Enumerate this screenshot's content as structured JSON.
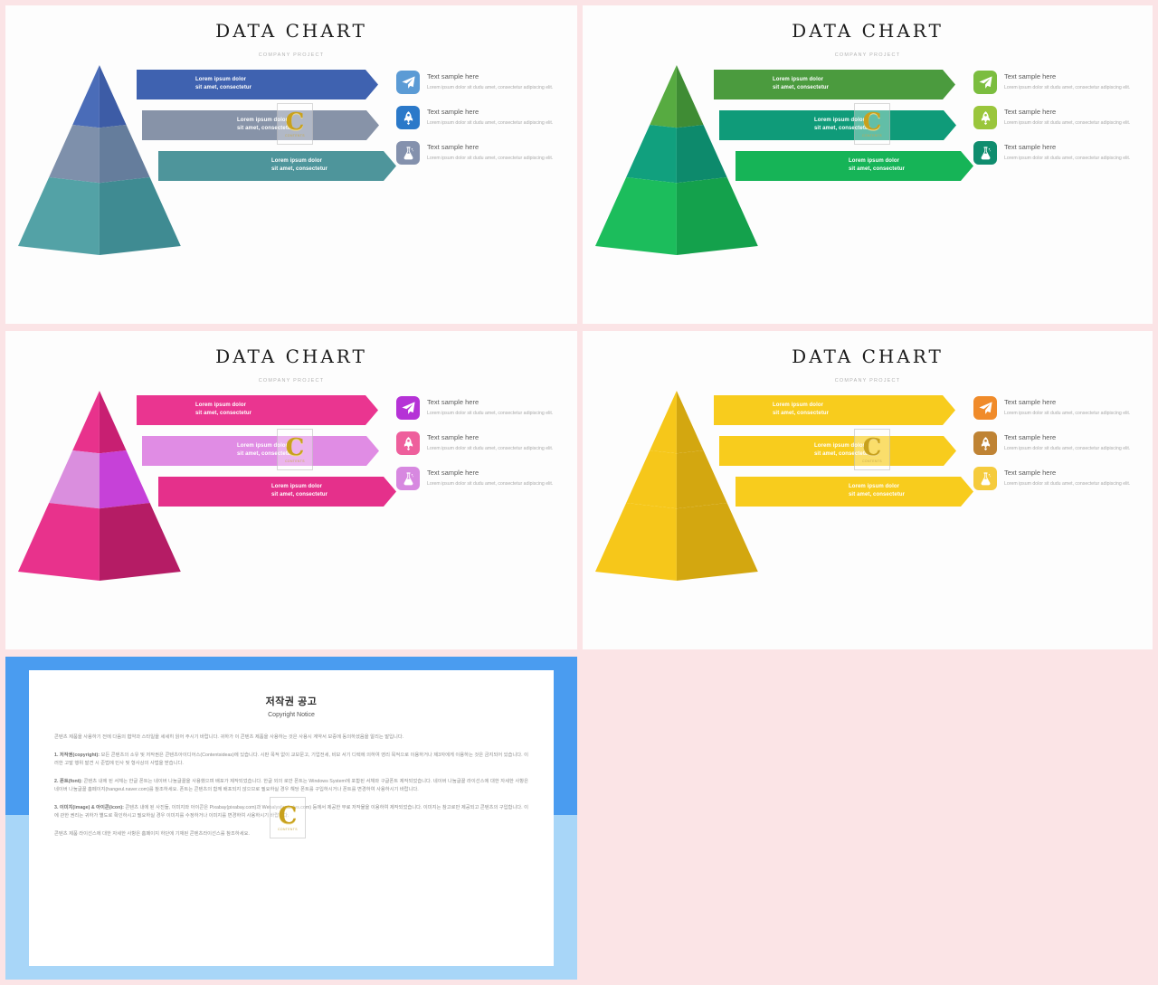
{
  "theme": {
    "page_background": "#fbe4e6",
    "panel_background": "#fdfdfd"
  },
  "slides": [
    {
      "id": "slide-blue",
      "title": "DATA CHART",
      "subtitle": "COMPANY PROJECT",
      "accent": "#3f62b0",
      "pyramid": {
        "tiers": [
          {
            "left": "#4a6cb8",
            "right": "#3d5ca6"
          },
          {
            "left": "#7e90ab",
            "right": "#657d9c"
          },
          {
            "left": "#53a2a6",
            "right": "#3f8b92"
          }
        ]
      },
      "banners": [
        {
          "fill": "#3f62b0",
          "line1": "Lorem ipsum dolor",
          "line2": "sit amet, consectetur"
        },
        {
          "fill": "#8793a8",
          "line1": "Lorem ipsum dolor",
          "line2": "sit amet, consectetur"
        },
        {
          "fill": "#4e959b",
          "line1": "Lorem ipsum dolor",
          "line2": "sit amet, consectetur"
        }
      ],
      "legend": [
        {
          "icon": "paper-plane-icon",
          "bg": "#5b9bd5",
          "head": "Text sample here",
          "body": "Lorem ipsum dolor sit dudu amet, consectetur adipiscing elit."
        },
        {
          "icon": "rocket-icon",
          "bg": "#2b79c9",
          "head": "Text sample here",
          "body": "Lorem ipsum dolor sit dudu amet, consectetur adipiscing elit."
        },
        {
          "icon": "flask-icon",
          "bg": "#8491ad",
          "head": "Text sample here",
          "body": "Lorem ipsum dolor sit dudu amet, consectetur adipiscing elit."
        }
      ]
    },
    {
      "id": "slide-green",
      "title": "DATA CHART",
      "subtitle": "COMPANY PROJECT",
      "accent": "#4a9c3f",
      "pyramid": {
        "tiers": [
          {
            "left": "#57ab41",
            "right": "#3f8c34"
          },
          {
            "left": "#11a07e",
            "right": "#0d8a6c"
          },
          {
            "left": "#1cbd5c",
            "right": "#14a14c"
          }
        ]
      },
      "banners": [
        {
          "fill": "#4b9b3e",
          "line1": "Lorem ipsum dolor",
          "line2": "sit amet, consectetur"
        },
        {
          "fill": "#0f9b79",
          "line1": "Lorem ipsum dolor",
          "line2": "sit amet, consectetur"
        },
        {
          "fill": "#16b457",
          "line1": "Lorem ipsum dolor",
          "line2": "sit amet, consectetur"
        }
      ],
      "legend": [
        {
          "icon": "paper-plane-icon",
          "bg": "#7bbd3f",
          "head": "Text sample here",
          "body": "Lorem ipsum dolor sit dudu amet, consectetur adipiscing elit."
        },
        {
          "icon": "rocket-icon",
          "bg": "#9ac63c",
          "head": "Text sample here",
          "body": "Lorem ipsum dolor sit dudu amet, consectetur adipiscing elit."
        },
        {
          "icon": "flask-icon",
          "bg": "#0f8d6e",
          "head": "Text sample here",
          "body": "Lorem ipsum dolor sit dudu amet, consectetur adipiscing elit."
        }
      ]
    },
    {
      "id": "slide-pink",
      "title": "DATA CHART",
      "subtitle": "COMPANY PROJECT",
      "accent": "#e8328c",
      "pyramid": {
        "tiers": [
          {
            "left": "#e8328c",
            "right": "#c81f72"
          },
          {
            "left": "#da8ede",
            "right": "#c641d8"
          },
          {
            "left": "#e8328c",
            "right": "#b51c65"
          }
        ]
      },
      "banners": [
        {
          "fill": "#ea3590",
          "line1": "Lorem ipsum dolor",
          "line2": "sit amet, consectetur"
        },
        {
          "fill": "#e08ce4",
          "line1": "Lorem ipsum dolor",
          "line2": "sit amet, consectetur"
        },
        {
          "fill": "#e5308b",
          "line1": "Lorem ipsum dolor",
          "line2": "sit amet, consectetur"
        }
      ],
      "legend": [
        {
          "icon": "paper-plane-icon",
          "bg": "#b532d6",
          "head": "Text sample here",
          "body": "Lorem ipsum dolor sit dudu amet, consectetur adipiscing elit."
        },
        {
          "icon": "rocket-icon",
          "bg": "#ee5f9c",
          "head": "Text sample here",
          "body": "Lorem ipsum dolor sit dudu amet, consectetur adipiscing elit."
        },
        {
          "icon": "flask-icon",
          "bg": "#d788e0",
          "head": "Text sample here",
          "body": "Lorem ipsum dolor sit dudu amet, consectetur adipiscing elit."
        }
      ]
    },
    {
      "id": "slide-yellow",
      "title": "DATA CHART",
      "subtitle": "COMPANY PROJECT",
      "accent": "#f5c518",
      "pyramid": {
        "tiers": [
          {
            "left": "#f6c71a",
            "right": "#d3a710"
          },
          {
            "left": "#f6c71a",
            "right": "#d3a710"
          },
          {
            "left": "#f6c71a",
            "right": "#d3a710"
          }
        ]
      },
      "banners": [
        {
          "fill": "#f8cc1d",
          "line1": "Lorem ipsum dolor",
          "line2": "sit amet, consectetur"
        },
        {
          "fill": "#f8cc1d",
          "line1": "Lorem ipsum dolor",
          "line2": "sit amet, consectetur"
        },
        {
          "fill": "#f8cc1d",
          "line1": "Lorem ipsum dolor",
          "line2": "sit amet, consectetur"
        }
      ],
      "legend": [
        {
          "icon": "paper-plane-icon",
          "bg": "#f08b2a",
          "head": "Text sample here",
          "body": "Lorem ipsum dolor sit dudu amet, consectetur adipiscing elit."
        },
        {
          "icon": "rocket-icon",
          "bg": "#bf8334",
          "head": "Text sample here",
          "body": "Lorem ipsum dolor sit dudu amet, consectetur adipiscing elit."
        },
        {
          "icon": "flask-icon",
          "bg": "#f5cb3d",
          "head": "Text sample here",
          "body": "Lorem ipsum dolor sit dudu amet, consectetur adipiscing elit."
        }
      ]
    }
  ],
  "watermark": {
    "letter": "C",
    "caption": "CONTENTS"
  },
  "copyright_slide": {
    "frame_top_color": "#4a9cf0",
    "frame_bottom_color": "#a8d6f8",
    "title": "저작권 공고",
    "subtitle": "Copyright Notice",
    "intro": "콘텐츠 제품을 사용하기 전에 다음의 협약과 스타일을 세세히 읽어 주시기 바랍니다. 귀하가 이 콘텐츠 제품을 사용하는 것은 사용시 계약서 보증에 동의하셨음을 알리는 말입니다.",
    "sections": [
      {
        "heading": "1. 저작권(copyright):",
        "text": "모든 콘텐츠의 소유 및 저작권은 콘텐츠아이디어스(Contentsideas)에 있습니다. 시판 목적 없이 교보문고, 기업전세, 비보 서기 디렉에 의하여 영리 목적으로 이용하거나 제3자에게 이용하는 것은 금지되어 있습니다. 이러한 고발 행위 발견 시 준법에 민사 및 형사상의 사법을 받습니다."
      },
      {
        "heading": "2. 폰트(font):",
        "text": "콘텐츠 내에 된 서체는 한글 폰트는 네이버 나눔글꼴을 사용했으며 배포가 제작되었습니다. 한글 외의 로만 폰트는 Windows System에 포함된 서체와 구글폰트 제작되었습니다. 네이버 나눔글꼴 라이선스에 대한 자세한 사항은 네이버 나눔글꼴 홈페이지(hangeul.naver.com)를 참조하세요. 폰트는 콘텐츠의 함께 배포되지 않으므로 필요하실 경우 해당 폰트를 구입하시거나 폰트를 변경하여 사용하시기 바랍니다."
      },
      {
        "heading": "3. 이미지(image) & 아이콘(icon):",
        "text": "콘텐츠 내에 된 사진들, 이미지와 아이콘은 Pixabay(pixabay.com)과 Webalys(webalys.com) 등에서 제공한 무료 저작물을 이용하여 제작되었습니다. 이미지는 참고로만 제공되고 콘텐츠의 구입합니다. 이에 관한 권리는 귀하가 별도로 확인하시고 필요하실 경우 이미지를 수정하거나 이미지를 변경하여 사용하시기 바랍니다."
      }
    ],
    "footer": "콘텐츠 제품 라이선스에 대한 자세한 사항은 홈페이지 하단에 기재된 콘텐츠라이선스를 참조하세요."
  }
}
